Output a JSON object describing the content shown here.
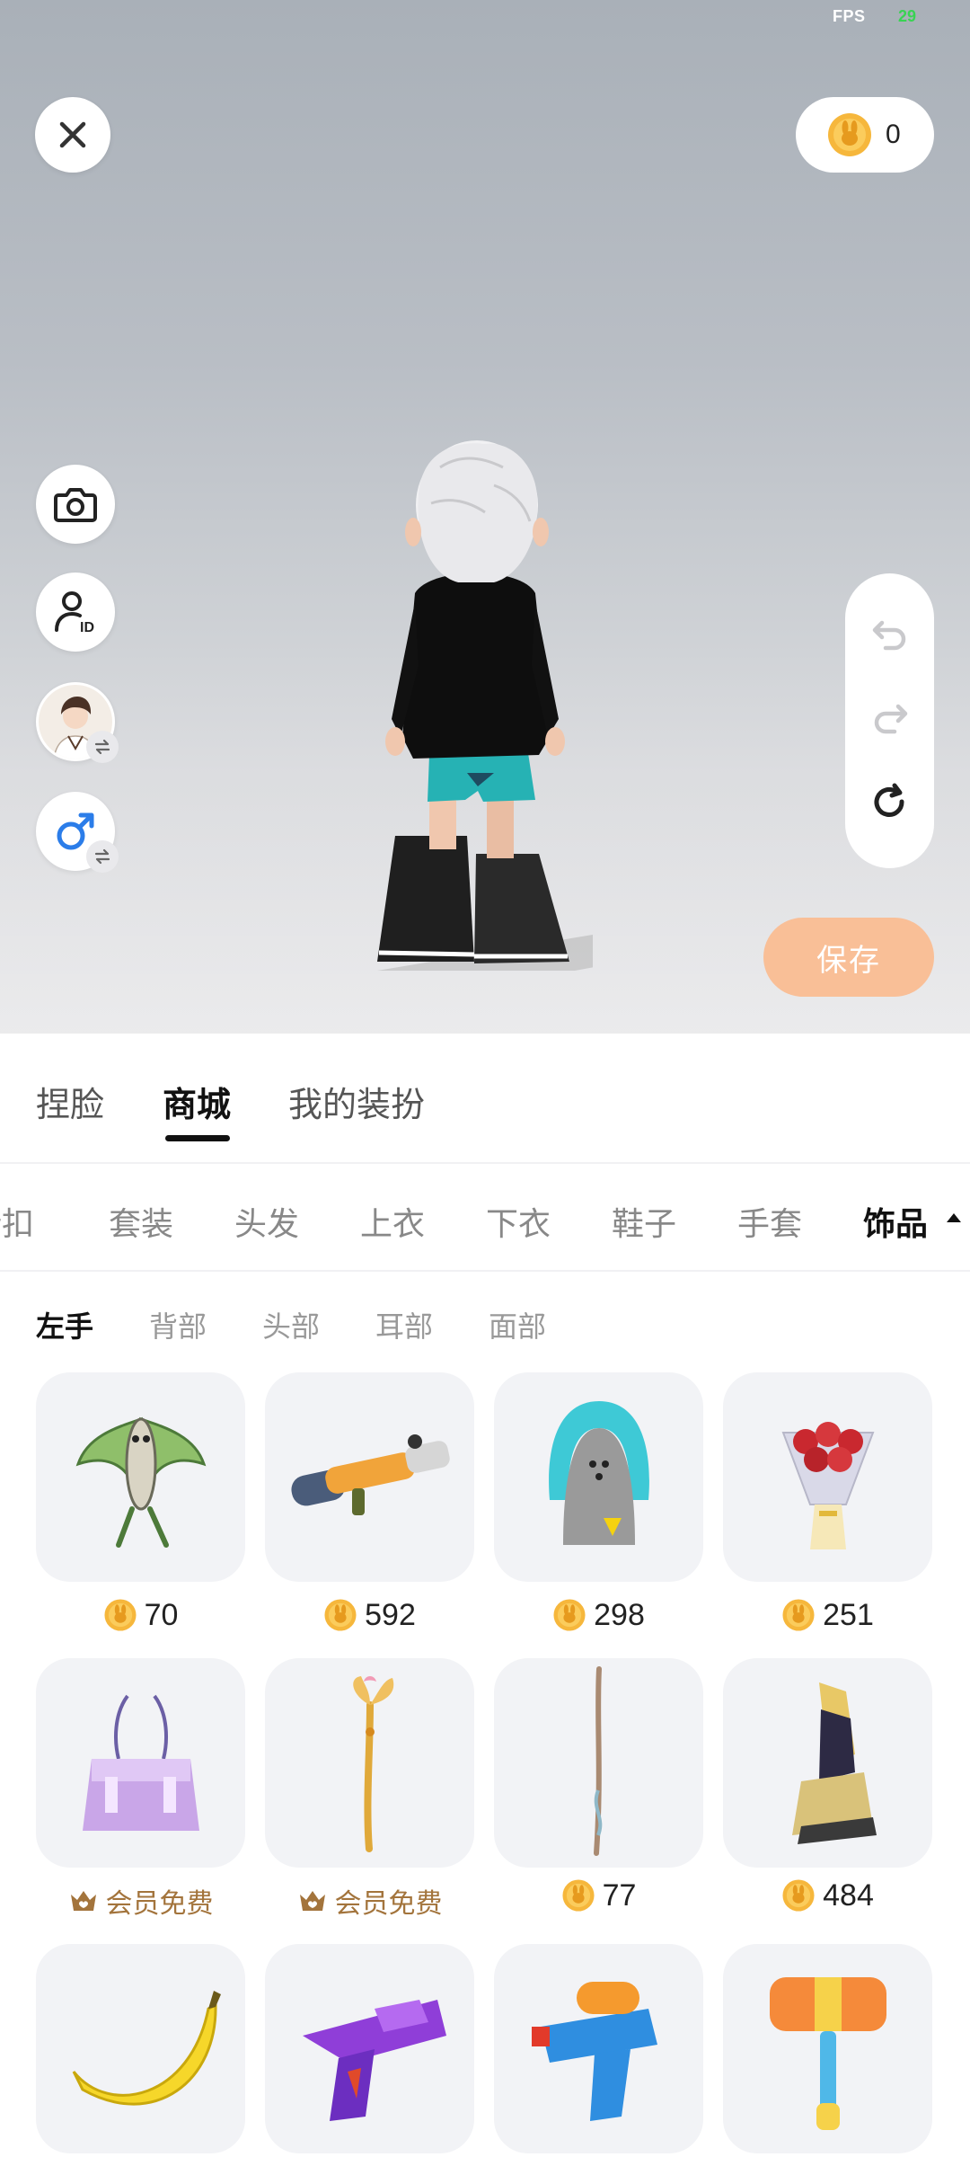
{
  "status": {
    "fps_label": "FPS",
    "fps_value": "29"
  },
  "header": {
    "coin_balance": "0"
  },
  "actions": {
    "save_label": "保存"
  },
  "main_tabs": [
    {
      "label": "捏脸"
    },
    {
      "label": "商城"
    },
    {
      "label": "我的装扮"
    }
  ],
  "categories": [
    {
      "label": "折扣"
    },
    {
      "label": "套装"
    },
    {
      "label": "头发"
    },
    {
      "label": "上衣"
    },
    {
      "label": "下衣"
    },
    {
      "label": "鞋子"
    },
    {
      "label": "手套"
    },
    {
      "label": "饰品"
    }
  ],
  "subcategories": [
    {
      "label": "左手"
    },
    {
      "label": "背部"
    },
    {
      "label": "头部"
    },
    {
      "label": "耳部"
    },
    {
      "label": "面部"
    }
  ],
  "items": [
    {
      "icon": "kite-icon",
      "price": "70"
    },
    {
      "icon": "bazooka-icon",
      "price": "592"
    },
    {
      "icon": "iron-icon",
      "price": "298"
    },
    {
      "icon": "bouquet-icon",
      "price": "251"
    },
    {
      "icon": "handbag-icon",
      "vip_label": "会员免费"
    },
    {
      "icon": "golden-staff-icon",
      "vip_label": "会员免费"
    },
    {
      "icon": "wooden-wand-icon",
      "price": "77"
    },
    {
      "icon": "gauntlet-icon",
      "price": "484"
    },
    {
      "icon": "banana-icon"
    },
    {
      "icon": "purple-blaster-icon"
    },
    {
      "icon": "water-gun-icon"
    },
    {
      "icon": "toy-hammer-icon"
    }
  ],
  "colors": {
    "accent": "#f9bf97",
    "coin": "#f6b73c",
    "vip": "#a3743c",
    "card_bg": "#f2f3f6"
  }
}
